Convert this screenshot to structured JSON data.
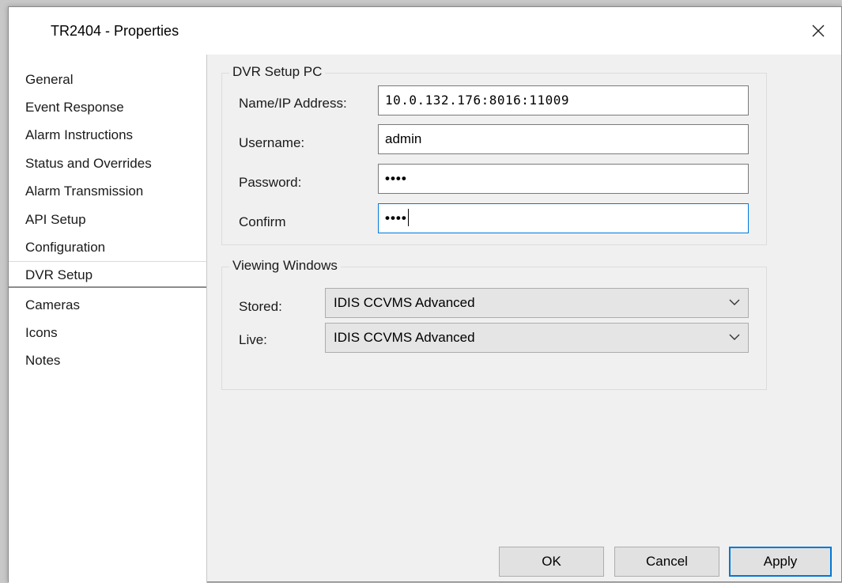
{
  "window": {
    "title": "TR2404 - Properties"
  },
  "nav": {
    "items": [
      {
        "label": "General"
      },
      {
        "label": "Event Response"
      },
      {
        "label": "Alarm Instructions"
      },
      {
        "label": "Status and Overrides"
      },
      {
        "label": "Alarm Transmission"
      },
      {
        "label": "API Setup"
      },
      {
        "label": "Configuration"
      },
      {
        "label": "DVR Setup",
        "selected": true
      },
      {
        "label": "Cameras"
      },
      {
        "label": "Icons"
      },
      {
        "label": "Notes"
      }
    ]
  },
  "dvr_setup_pc": {
    "legend": "DVR Setup PC",
    "address_label": "Name/IP Address:",
    "address_value": "10.0.132.176:8016:11009",
    "username_label": "Username:",
    "username_value": "admin",
    "password_label": "Password:",
    "password_value": "••••",
    "confirm_label": "Confirm",
    "confirm_value": "••••"
  },
  "viewing_windows": {
    "legend": "Viewing Windows",
    "stored_label": "Stored:",
    "stored_value": "IDIS CCVMS Advanced",
    "live_label": "Live:",
    "live_value": "IDIS CCVMS Advanced"
  },
  "buttons": {
    "ok": "OK",
    "cancel": "Cancel",
    "apply": "Apply"
  },
  "colors": {
    "focus_accent": "#0078d7",
    "dialog_bg": "#f0f0f0"
  }
}
